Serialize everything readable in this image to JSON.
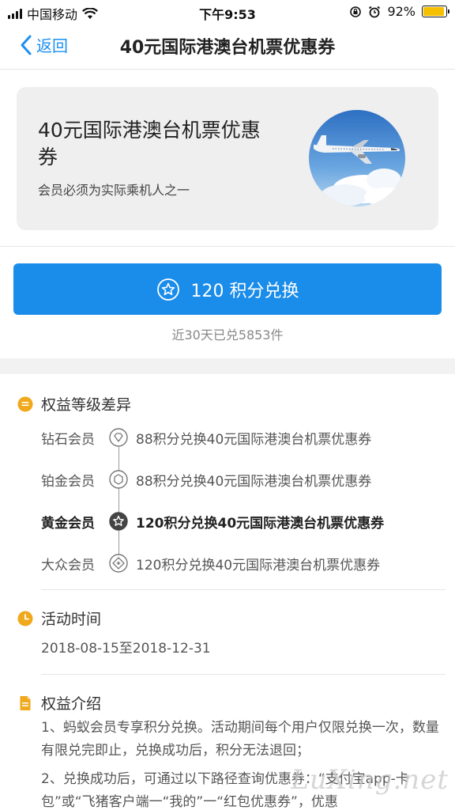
{
  "status_bar": {
    "carrier": "中国移动",
    "time": "下午9:53",
    "battery_percent": "92%",
    "battery_level": 0.92,
    "battery_color": "#f5c000"
  },
  "nav": {
    "back_label": "返回",
    "title": "40元国际港澳台机票优惠券"
  },
  "hero": {
    "title": "40元国际港澳台机票优惠券",
    "subtitle": "会员必须为实际乘机人之一",
    "image_icon": "airplane-in-clouds"
  },
  "redeem": {
    "label": "120 积分兑换",
    "note": "近30天已兑5853件",
    "accent": "#1a8cea"
  },
  "tiers_section": {
    "heading": "权益等级差异",
    "items": [
      {
        "name": "钻石会员",
        "desc": "88积分兑换40元国际港澳台机票优惠券",
        "icon": "diamond-icon"
      },
      {
        "name": "铂金会员",
        "desc": "88积分兑换40元国际港澳台机票优惠券",
        "icon": "hexagon-icon"
      },
      {
        "name": "黄金会员",
        "desc": "120积分兑换40元国际港澳台机票优惠券",
        "icon": "star-icon"
      },
      {
        "name": "大众会员",
        "desc": "120积分兑换40元国际港澳台机票优惠券",
        "icon": "diamond-star-icon"
      }
    ]
  },
  "time_section": {
    "heading": "活动时间",
    "value": "2018-08-15至2018-12-31"
  },
  "intro_section": {
    "heading": "权益介绍",
    "p1": "1、蚂蚁会员专享积分兑换。活动期间每个用户仅限兑换一次，数量有限兑完即止，兑换成功后，积分无法退回；",
    "p2": "2、兑换成功后，可通过以下路径查询优惠券：“支付宝app-卡包”或“飞猪客户端一“我的”一“红包优惠券”，优惠"
  },
  "watermark": "LuXing.net",
  "section_icon_color": "#f0a81c"
}
